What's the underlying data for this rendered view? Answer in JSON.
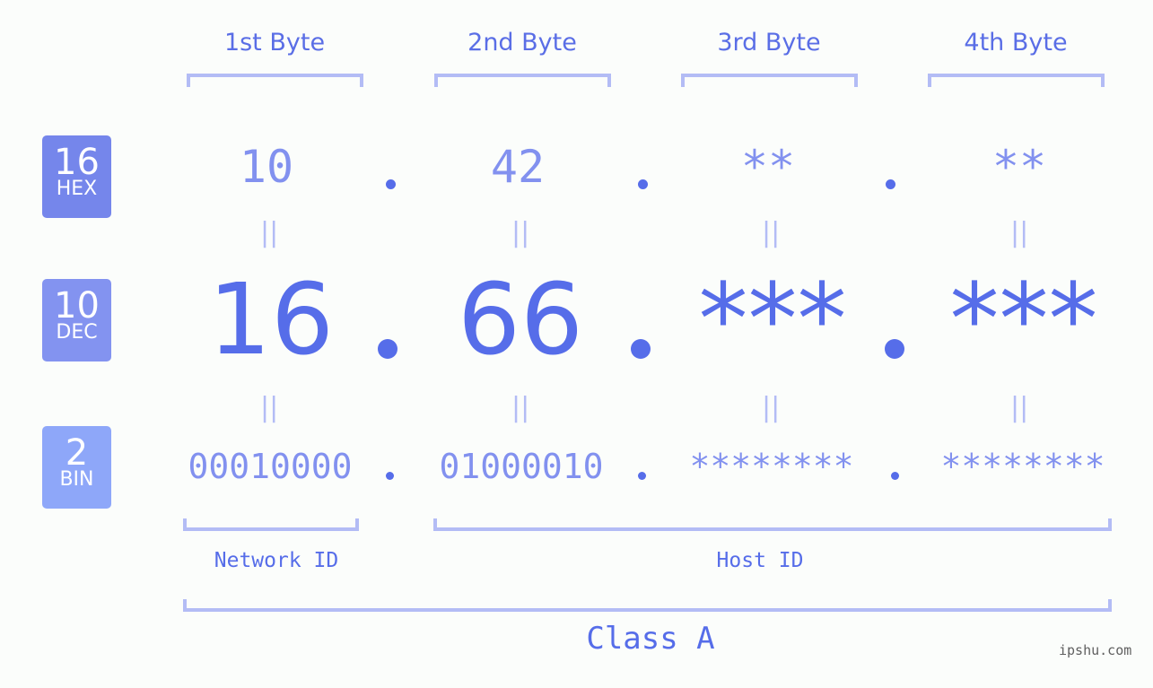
{
  "bytes": {
    "headers": [
      "1st Byte",
      "2nd Byte",
      "3rd Byte",
      "4th Byte"
    ]
  },
  "badges": [
    {
      "num": "16",
      "label": "HEX",
      "color": "#7586eb"
    },
    {
      "num": "10",
      "label": "DEC",
      "color": "#8393f0"
    },
    {
      "num": "2",
      "label": "BIN",
      "color": "#8ea7f9"
    }
  ],
  "hex": [
    "10",
    "42",
    "**",
    "**"
  ],
  "dec": [
    "16",
    "66",
    "***",
    "***"
  ],
  "bin": [
    "00010000",
    "01000010",
    "********",
    "********"
  ],
  "equals_symbol": "||",
  "labels": {
    "network": "Network ID",
    "host": "Host ID",
    "class": "Class A"
  },
  "brand": "ipshu.com",
  "colors": {
    "accent": "#566de9",
    "light": "#8291ef",
    "bracket": "#b3bcf5"
  }
}
